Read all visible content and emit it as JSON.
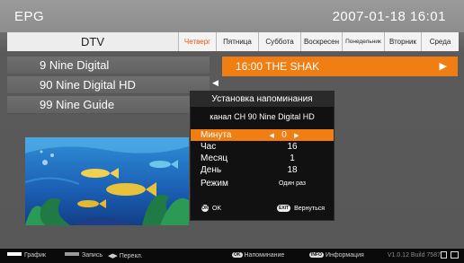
{
  "header": {
    "title": "EPG",
    "datetime": "2007-01-18  16:01"
  },
  "channel_list_header": "DTV",
  "tabs": [
    {
      "label": "Четверг",
      "active": true
    },
    {
      "label": "Пятница",
      "active": false
    },
    {
      "label": "Суббота",
      "active": false
    },
    {
      "label": "Воскресен",
      "active": false
    },
    {
      "label": "Понедельник",
      "active": false
    },
    {
      "label": "Вторник",
      "active": false
    },
    {
      "label": "Среда",
      "active": false
    }
  ],
  "channels": [
    {
      "label": "9 Nine Digital"
    },
    {
      "label": "90 Nine Digital HD"
    },
    {
      "label": "99 Nine Guide"
    }
  ],
  "program": {
    "label": "16:00 THE SHAK"
  },
  "dialog": {
    "title": "Установка напоминания",
    "channel_line": "канал  CH 90 Nine Digital HD",
    "fields": {
      "minute_label": "Минута",
      "minute_value": "0",
      "hour_label": "Час",
      "hour_value": "16",
      "month_label": "Месяц",
      "month_value": "1",
      "day_label": "День",
      "day_value": "18",
      "mode_label": "Режим",
      "mode_value": "Один раз"
    },
    "ok_key": "OK",
    "ok_label": "OK",
    "back_key": "EXIT",
    "back_label": "Вернуться"
  },
  "footer": {
    "schedule": "График",
    "record": "Запись",
    "switch": "Перекл.",
    "reminder_key": "OK",
    "reminder": "Напоминание",
    "info_key": "INFO",
    "info": "Информация",
    "version": "V1.0.12 Build 7587"
  },
  "colors": {
    "accent": "#f07e12",
    "schedule_swatch": "#ffffff",
    "record_swatch": "#9a9a9a"
  }
}
